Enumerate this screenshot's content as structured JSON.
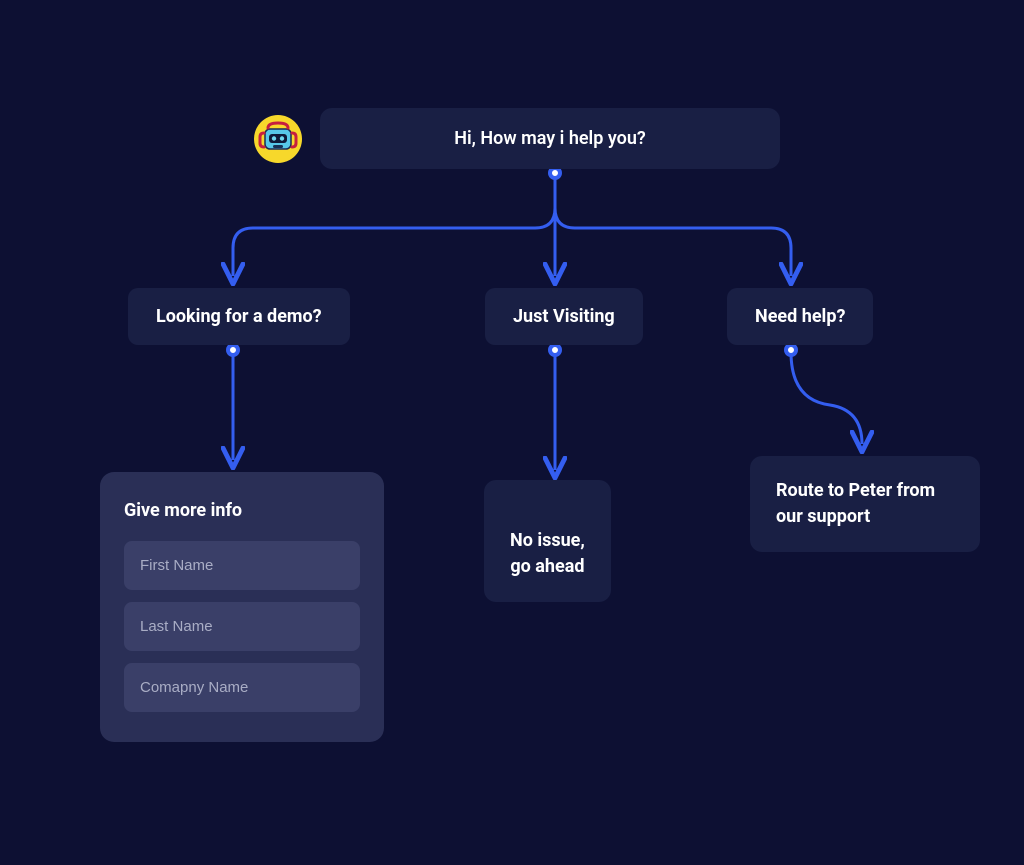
{
  "colors": {
    "background": "#0d1033",
    "node": "#191f44",
    "card": "#2a2f56",
    "input": "#3a3f68",
    "connector": "#345ef0",
    "avatar_bg": "#f7d82b"
  },
  "root": {
    "message": "Hi, How may i help you?"
  },
  "options": [
    {
      "label": "Looking for a demo?"
    },
    {
      "label": "Just Visiting"
    },
    {
      "label": "Need help?"
    }
  ],
  "results": {
    "form": {
      "title": "Give more info",
      "fields": [
        {
          "placeholder": "First Name"
        },
        {
          "placeholder": "Last Name"
        },
        {
          "placeholder": "Comapny Name"
        }
      ]
    },
    "visiting": "No issue,\ngo ahead",
    "help": "Route to Peter from our support"
  }
}
